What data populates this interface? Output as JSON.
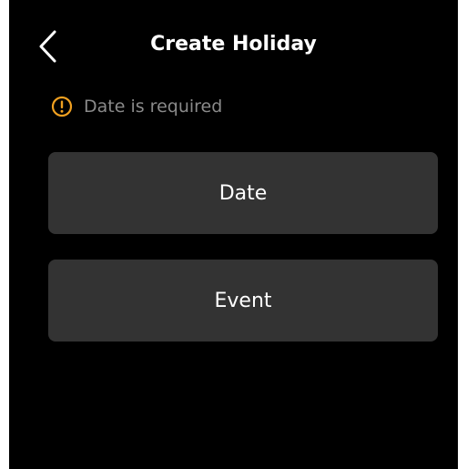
{
  "header": {
    "title": "Create Holiday",
    "back_icon": "chevron-left-icon"
  },
  "validation": {
    "message": "Date is required",
    "icon": "warning-circle-icon",
    "color": "#f0a020"
  },
  "fields": {
    "date_label": "Date",
    "event_label": "Event"
  },
  "colors": {
    "background": "#000000",
    "button": "#333333",
    "muted_text": "#8a8a8a"
  }
}
